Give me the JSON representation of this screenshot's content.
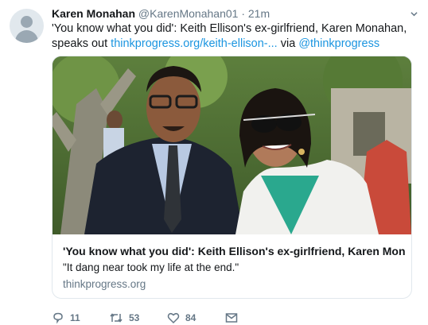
{
  "tweet": {
    "author_name": "Karen Monahan",
    "author_handle": "@KarenMonahan01",
    "separator": "·",
    "time": "21m",
    "text_main": "'You know what you did': Keith Ellison's ex-girlfriend, Karen Monahan, speaks out ",
    "text_link": "thinkprogress.org/keith-ellison-...",
    "text_via": " via ",
    "text_mention": "@thinkprogress"
  },
  "card": {
    "title": "'You know what you did': Keith Ellison's ex-girlfriend, Karen Mon…",
    "description": "\"It dang near took my life at the end.\"",
    "domain": "thinkprogress.org"
  },
  "actions": {
    "replies": "11",
    "retweets": "53",
    "likes": "84"
  },
  "icons": {
    "reply": "reply-icon",
    "retweet": "retweet-icon",
    "like": "heart-icon",
    "message": "envelope-icon",
    "menu": "chevron-down-icon"
  },
  "colors": {
    "link": "#1b95e0",
    "secondary_text": "#657786"
  }
}
